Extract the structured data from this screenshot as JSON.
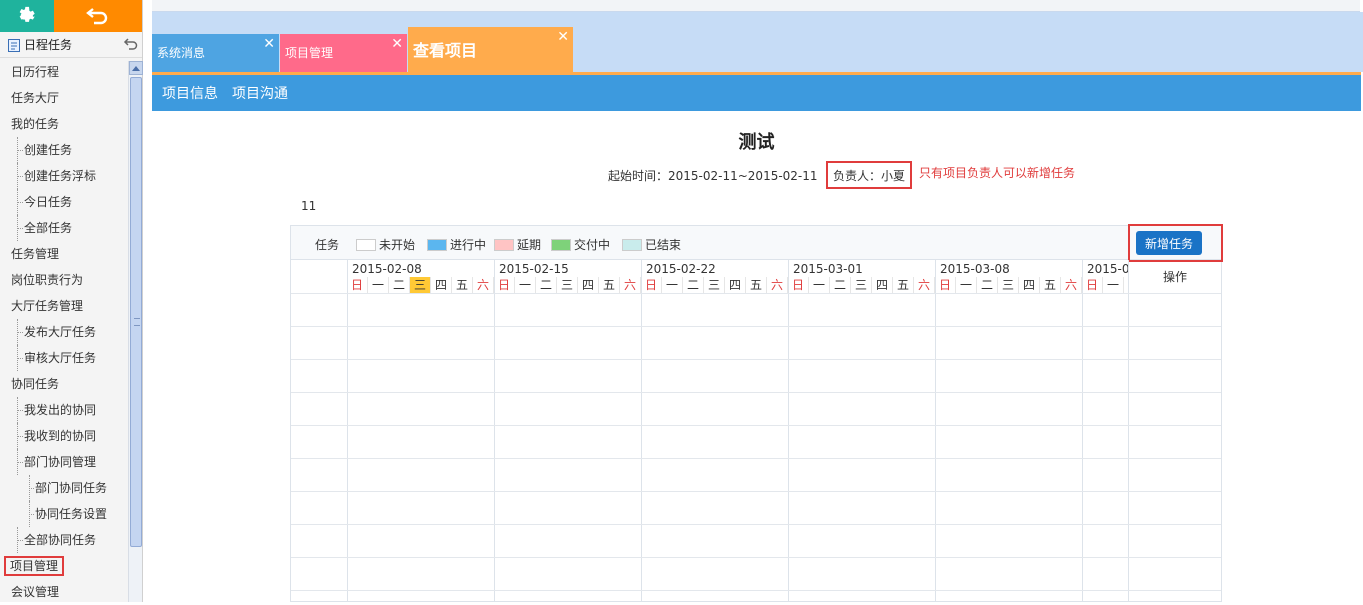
{
  "sidebar": {
    "header": "日程任务",
    "items": [
      {
        "label": "日历行程",
        "level": 1
      },
      {
        "label": "任务大厅",
        "level": 1
      },
      {
        "label": "我的任务",
        "level": 1
      },
      {
        "label": "创建任务",
        "level": 2
      },
      {
        "label": "创建任务浮标",
        "level": 2
      },
      {
        "label": "今日任务",
        "level": 2
      },
      {
        "label": "全部任务",
        "level": 2
      },
      {
        "label": "任务管理",
        "level": 1
      },
      {
        "label": "岗位职责行为",
        "level": 1
      },
      {
        "label": "大厅任务管理",
        "level": 1
      },
      {
        "label": "发布大厅任务",
        "level": 2
      },
      {
        "label": "审核大厅任务",
        "level": 2
      },
      {
        "label": "协同任务",
        "level": 1
      },
      {
        "label": "我发出的协同",
        "level": 2
      },
      {
        "label": "我收到的协同",
        "level": 2
      },
      {
        "label": "部门协同管理",
        "level": 2
      },
      {
        "label": "部门协同任务",
        "level": 3
      },
      {
        "label": "协同任务设置",
        "level": 3
      },
      {
        "label": "全部协同任务",
        "level": 2
      },
      {
        "label": "项目管理",
        "level": 1,
        "highlight": true
      },
      {
        "label": "会议管理",
        "level": 1
      }
    ]
  },
  "tabs": [
    {
      "label": "系统消息"
    },
    {
      "label": "项目管理"
    },
    {
      "label": "查看项目",
      "active": true
    }
  ],
  "subnav": [
    "项目信息",
    "项目沟通"
  ],
  "project": {
    "title": "测试",
    "period_label": "起始时间：2015-02-11~2015-02-11",
    "owner_label": "负责人：小夏",
    "note": "只有项目负责人可以新增任务",
    "count": "11"
  },
  "gantt": {
    "task_label": "任务",
    "legend": [
      {
        "label": "未开始",
        "color": "#ffffff"
      },
      {
        "label": "进行中",
        "color": "#5bb6ef"
      },
      {
        "label": "延期",
        "color": "#ffc4c4"
      },
      {
        "label": "交付中",
        "color": "#7ed27a"
      },
      {
        "label": "已结束",
        "color": "#c9ecec"
      }
    ],
    "add_button": "新增任务",
    "op_label": "操作",
    "weeks": [
      "2015-02-08",
      "2015-02-15",
      "2015-02-22",
      "2015-03-01",
      "2015-03-08",
      "2015-0"
    ],
    "days": [
      "日",
      "一",
      "二",
      "三",
      "四",
      "五",
      "六"
    ],
    "last_week_days": [
      "日",
      "一"
    ],
    "today_week": 0,
    "today_day": 3
  },
  "colors": {
    "teal": "#1fb39d",
    "orange": "#ff8a00",
    "blue": "#3d9ade",
    "pink": "#ff6a8a",
    "red": "#e03c3c"
  }
}
